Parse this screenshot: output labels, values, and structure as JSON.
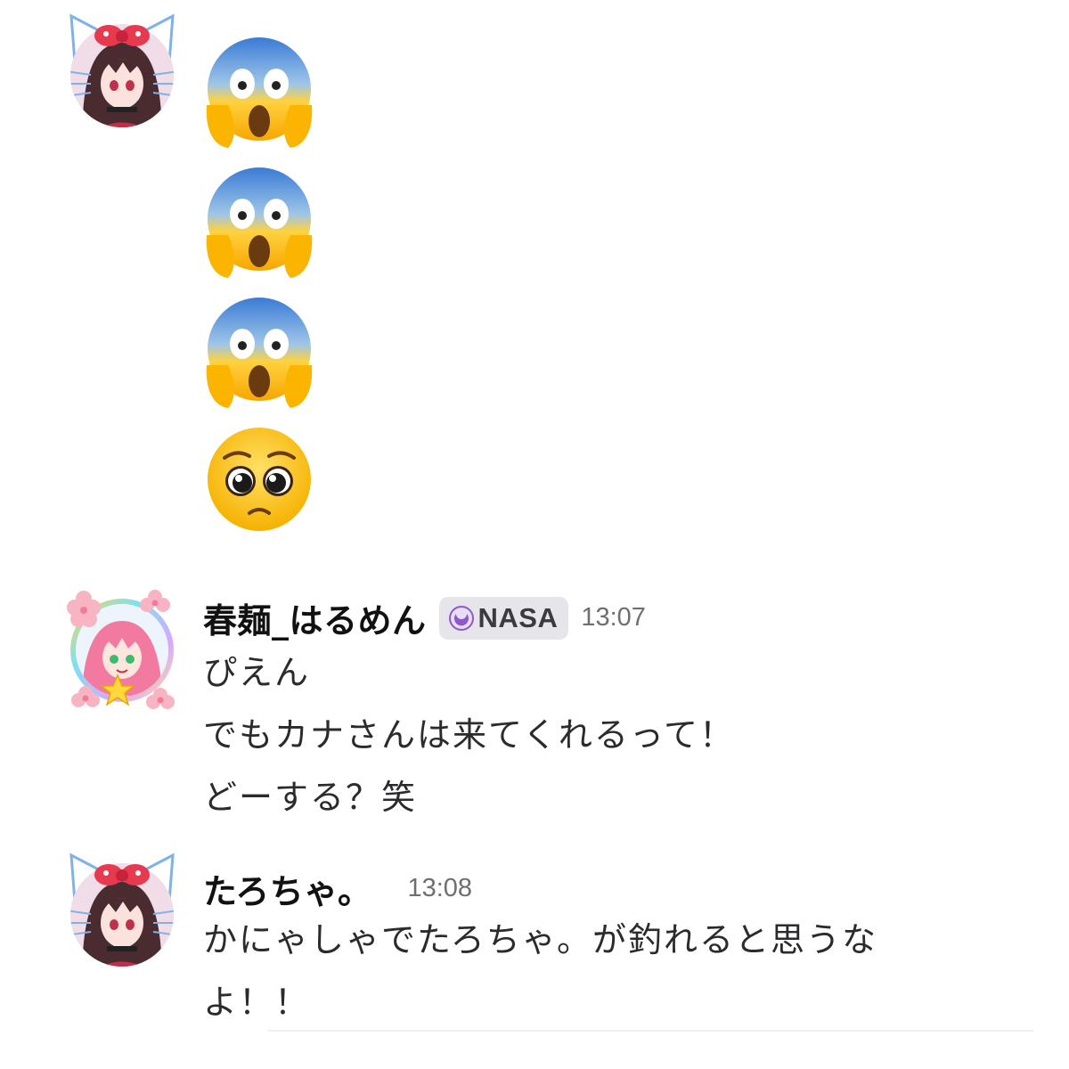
{
  "messages": [
    {
      "avatar": "kitty-ear-girl-avatar",
      "emojis": [
        "face-screaming-in-fear",
        "face-screaming-in-fear",
        "face-screaming-in-fear",
        "pleading-face"
      ]
    },
    {
      "avatar": "pink-hair-girl-avatar",
      "username": "春麺_はるめん",
      "badge": {
        "icon": "moon-icon",
        "label": "NASA"
      },
      "time": "13:07",
      "lines": [
        "ぴえん",
        "でもカナさんは来てくれるって！",
        "どーする？笑"
      ]
    },
    {
      "avatar": "kitty-ear-girl-avatar",
      "username": "たろちゃ。",
      "time": "13:08",
      "lines": [
        "かにゃしゃでたろちゃ。が釣れると思うな",
        "よ！！"
      ]
    }
  ],
  "colors": {
    "badge_bg": "#e6e6ea",
    "timestamp": "#6e6e73",
    "badge_moon": "#8e59c9"
  }
}
